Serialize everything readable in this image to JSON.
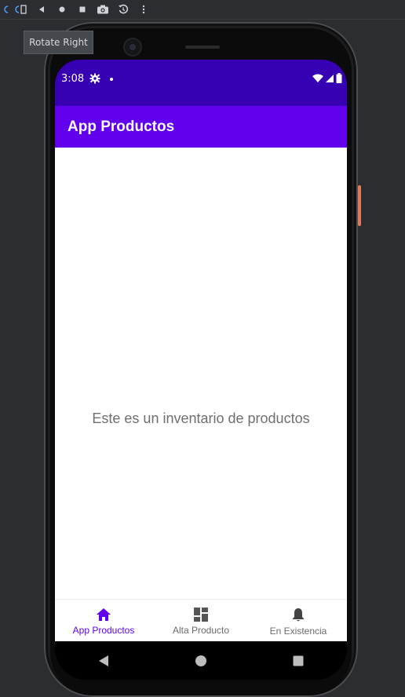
{
  "toolbar": {
    "items": [
      "rotate-left-icon",
      "rotate-right-icon",
      "back-icon",
      "home-icon",
      "overview-icon",
      "camera-icon",
      "replay-icon",
      "more-icon"
    ]
  },
  "tooltip": {
    "text": "Rotate Right"
  },
  "status": {
    "time": "3:08"
  },
  "appbar": {
    "title": "App Productos"
  },
  "content": {
    "message": "Este es un inventario de productos"
  },
  "bottom_nav": {
    "items": [
      {
        "label": "App Productos",
        "icon": "home-icon",
        "active": true
      },
      {
        "label": "Alta Producto",
        "icon": "dashboard-icon",
        "active": false
      },
      {
        "label": "En Existencia",
        "icon": "bell-icon",
        "active": false
      }
    ]
  },
  "colors": {
    "status_bar": "#3700b3",
    "app_bar": "#6200ee",
    "active": "#6200ee",
    "inactive": "#6b6b6b"
  }
}
